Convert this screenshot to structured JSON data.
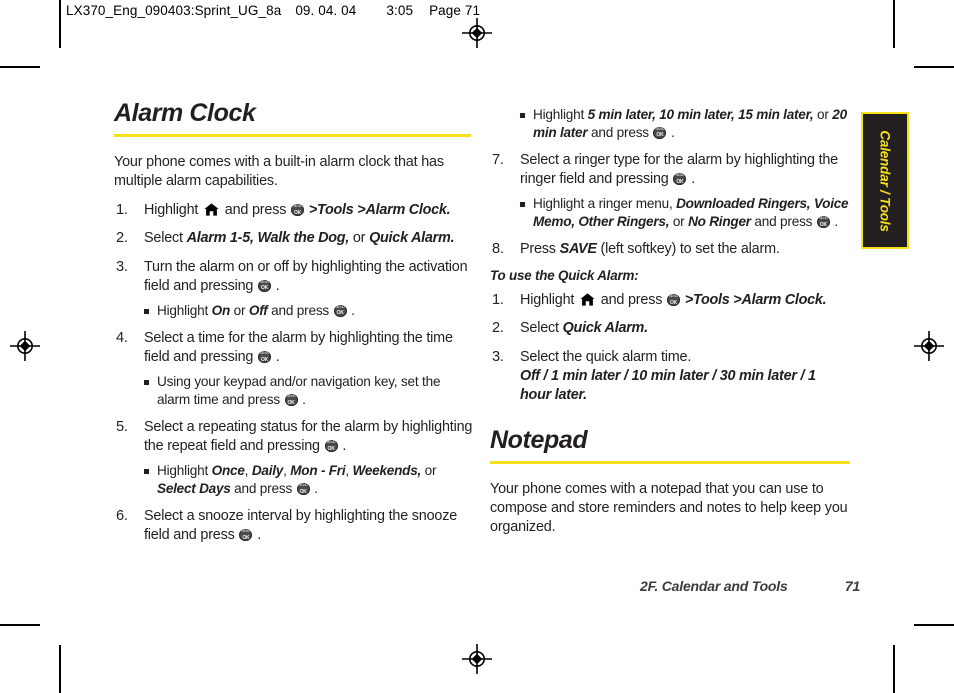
{
  "page": {
    "slug": {
      "file": "LX370_Eng_090403:Sprint_UG_8a",
      "date": "09. 04. 04",
      "time": "3:05",
      "page_label": "Page 71"
    },
    "footer": {
      "chapter": "2F. Calendar and Tools",
      "page_number": "71"
    },
    "thumb_tab": "Calendar / Tools",
    "accent_color": "#f5e119",
    "tab_bg_color": "#231f20",
    "text_color": "#231f20"
  },
  "icons": {
    "ok_key": "menu-ok-key-icon",
    "home_key": "home-key-icon",
    "registration": "registration-mark-icon"
  },
  "sections": [
    {
      "id": "alarm-clock",
      "title": "Alarm Clock",
      "intro": "Your phone comes with a built-in alarm clock that has multiple alarm capabilities.",
      "steps": [
        {
          "num": "1.",
          "parts": [
            {
              "t": "text",
              "v": "Highlight "
            },
            {
              "t": "icon",
              "v": "home"
            },
            {
              "t": "text",
              "v": " and press "
            },
            {
              "t": "icon",
              "v": "ok"
            },
            {
              "t": "text",
              "v": " "
            },
            {
              "t": "em",
              "v": ">Tools >Alarm Clock."
            }
          ]
        },
        {
          "num": "2.",
          "parts": [
            {
              "t": "text",
              "v": "Select "
            },
            {
              "t": "em",
              "v": "Alarm 1-5, Walk the Dog,"
            },
            {
              "t": "text",
              "v": " or "
            },
            {
              "t": "em",
              "v": "Quick Alarm."
            }
          ]
        },
        {
          "num": "3.",
          "parts": [
            {
              "t": "text",
              "v": "Turn the alarm on or off by highlighting the activation field and pressing "
            },
            {
              "t": "icon",
              "v": "ok"
            },
            {
              "t": "text",
              "v": " ."
            }
          ],
          "subs": [
            {
              "parts": [
                {
                  "t": "text",
                  "v": "Highlight "
                },
                {
                  "t": "em",
                  "v": "On"
                },
                {
                  "t": "text",
                  "v": "  or "
                },
                {
                  "t": "em",
                  "v": "Off"
                },
                {
                  "t": "text",
                  "v": "  and press "
                },
                {
                  "t": "icon",
                  "v": "ok"
                },
                {
                  "t": "text",
                  "v": " ."
                }
              ]
            }
          ]
        },
        {
          "num": "4.",
          "parts": [
            {
              "t": "text",
              "v": "Select a time for the alarm by highlighting the time field and pressing "
            },
            {
              "t": "icon",
              "v": "ok"
            },
            {
              "t": "text",
              "v": " ."
            }
          ],
          "subs": [
            {
              "parts": [
                {
                  "t": "text",
                  "v": "Using your keypad and/or navigation key, set the alarm time and press "
                },
                {
                  "t": "icon",
                  "v": "ok"
                },
                {
                  "t": "text",
                  "v": " ."
                }
              ]
            }
          ]
        },
        {
          "num": "5.",
          "parts": [
            {
              "t": "text",
              "v": "Select a repeating status for the alarm by highlighting the repeat field and pressing "
            },
            {
              "t": "icon",
              "v": "ok"
            },
            {
              "t": "text",
              "v": " ."
            }
          ],
          "subs": [
            {
              "parts": [
                {
                  "t": "text",
                  "v": "Highlight "
                },
                {
                  "t": "em",
                  "v": "Once"
                },
                {
                  "t": "text",
                  "v": ", "
                },
                {
                  "t": "em",
                  "v": "Daily"
                },
                {
                  "t": "text",
                  "v": ", "
                },
                {
                  "t": "em",
                  "v": "Mon - Fri"
                },
                {
                  "t": "text",
                  "v": ", "
                },
                {
                  "t": "em",
                  "v": "Weekends,"
                },
                {
                  "t": "text",
                  "v": " or "
                },
                {
                  "t": "em",
                  "v": "Select Days"
                },
                {
                  "t": "text",
                  "v": " and press "
                },
                {
                  "t": "icon",
                  "v": "ok"
                },
                {
                  "t": "text",
                  "v": " ."
                }
              ]
            }
          ]
        },
        {
          "num": "6.",
          "parts": [
            {
              "t": "text",
              "v": "Select a snooze interval by highlighting the snooze field and press "
            },
            {
              "t": "icon",
              "v": "ok"
            },
            {
              "t": "text",
              "v": " ."
            }
          ]
        }
      ]
    },
    {
      "id": "alarm-clock-continued",
      "steps": [
        {
          "num": "",
          "is_bullet_only": true,
          "subs": [
            {
              "parts": [
                {
                  "t": "text",
                  "v": "Highlight "
                },
                {
                  "t": "em",
                  "v": "5 min later, 10 min later, 15 min later,"
                },
                {
                  "t": "text",
                  "v": " or "
                },
                {
                  "t": "em",
                  "v": "20 min later"
                },
                {
                  "t": "text",
                  "v": " and press "
                },
                {
                  "t": "icon",
                  "v": "ok"
                },
                {
                  "t": "text",
                  "v": " ."
                }
              ]
            }
          ]
        },
        {
          "num": "7.",
          "parts": [
            {
              "t": "text",
              "v": "Select a ringer type for the alarm by highlighting the ringer field and pressing "
            },
            {
              "t": "icon",
              "v": "ok"
            },
            {
              "t": "text",
              "v": " ."
            }
          ],
          "subs": [
            {
              "parts": [
                {
                  "t": "text",
                  "v": "Highlight a ringer menu, "
                },
                {
                  "t": "em",
                  "v": "Downloaded Ringers, Voice Memo, Other Ringers,"
                },
                {
                  "t": "text",
                  "v": " or "
                },
                {
                  "t": "em",
                  "v": "No Ringer"
                },
                {
                  "t": "text",
                  "v": " and press "
                },
                {
                  "t": "icon",
                  "v": "ok"
                },
                {
                  "t": "text",
                  "v": " ."
                }
              ]
            }
          ]
        },
        {
          "num": "8.",
          "parts": [
            {
              "t": "text",
              "v": "Press "
            },
            {
              "t": "em",
              "v": "SAVE"
            },
            {
              "t": "text",
              "v": " (left softkey) to set the alarm."
            }
          ]
        }
      ]
    },
    {
      "id": "quick-alarm",
      "lead_in": "To use the Quick Alarm:",
      "steps": [
        {
          "num": "1.",
          "parts": [
            {
              "t": "text",
              "v": "Highlight "
            },
            {
              "t": "icon",
              "v": "home"
            },
            {
              "t": "text",
              "v": " and press "
            },
            {
              "t": "icon",
              "v": "ok"
            },
            {
              "t": "text",
              "v": " "
            },
            {
              "t": "em",
              "v": ">Tools >Alarm Clock."
            }
          ]
        },
        {
          "num": "2.",
          "parts": [
            {
              "t": "text",
              "v": "Select "
            },
            {
              "t": "em",
              "v": "Quick Alarm."
            }
          ]
        },
        {
          "num": "3.",
          "parts": [
            {
              "t": "text",
              "v": "Select the quick alarm time."
            }
          ],
          "sub_line": "Off / 1 min later / 10 min later / 30 min later / 1 hour later."
        }
      ]
    },
    {
      "id": "notepad",
      "title": "Notepad",
      "intro": "Your phone comes with a notepad that you can use to compose and store reminders and notes to help keep you organized."
    }
  ]
}
